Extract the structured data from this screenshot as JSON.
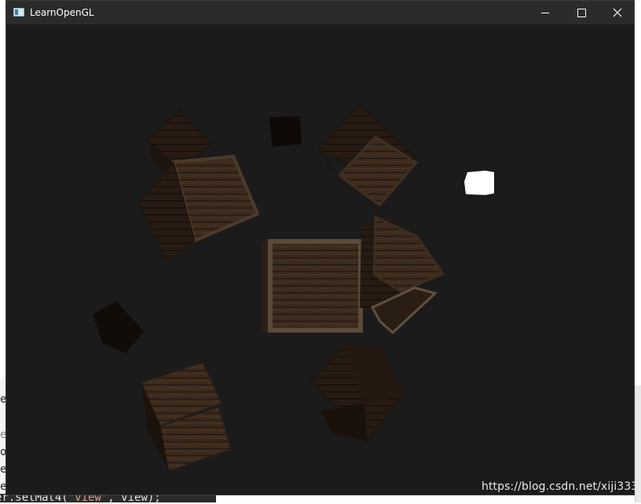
{
  "window": {
    "title": "LearnOpenGL",
    "minimize_icon": "minimize-icon",
    "maximize_icon": "maximize-icon",
    "close_icon": "close-icon"
  },
  "background_editor": {
    "line_chars": [
      "e",
      "e",
      "o",
      "e",
      "e"
    ],
    "code_prefix": "er.setMat4(",
    "code_string": "\"view\"",
    "code_suffix": ", view);"
  },
  "scene": {
    "background_color": "#1b1b1b",
    "light_color": "#ffffff",
    "crate_color": "#3a2a1e"
  },
  "watermark": "https://blog.csdn.net/xiji333"
}
